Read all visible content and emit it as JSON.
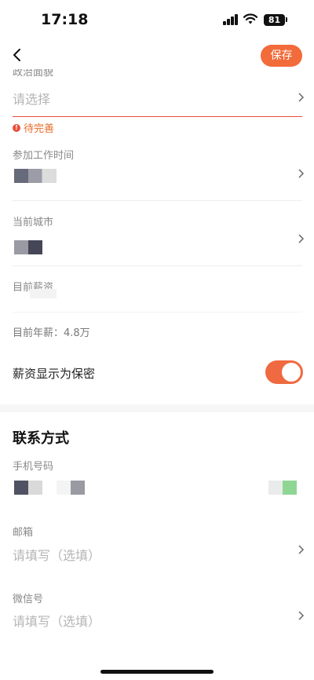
{
  "status_bar": {
    "time": "17:18",
    "battery": "81",
    "icons": [
      "signal-icon",
      "wifi-icon",
      "battery-icon"
    ]
  },
  "nav": {
    "back_icon": "chevron-left-icon",
    "save_label": "保存",
    "accent_color": "#f26b3a"
  },
  "fields": {
    "political_status": {
      "label": "政治面貌",
      "placeholder": "请选择",
      "status": "待完善"
    },
    "work_start_time": {
      "label": "参加工作时间"
    },
    "current_city": {
      "label": "当前城市"
    },
    "current_salary": {
      "label": "目前薪资"
    },
    "annual_salary_text": "目前年薪：4.8万"
  },
  "salary_private": {
    "label": "薪资显示为保密",
    "enabled": true
  },
  "contact": {
    "title": "联系方式",
    "phone_label": "手机号码",
    "email_label": "邮箱",
    "email_placeholder": "请填写（选填）",
    "wechat_label": "微信号",
    "wechat_placeholder": "请填写（选填）"
  }
}
